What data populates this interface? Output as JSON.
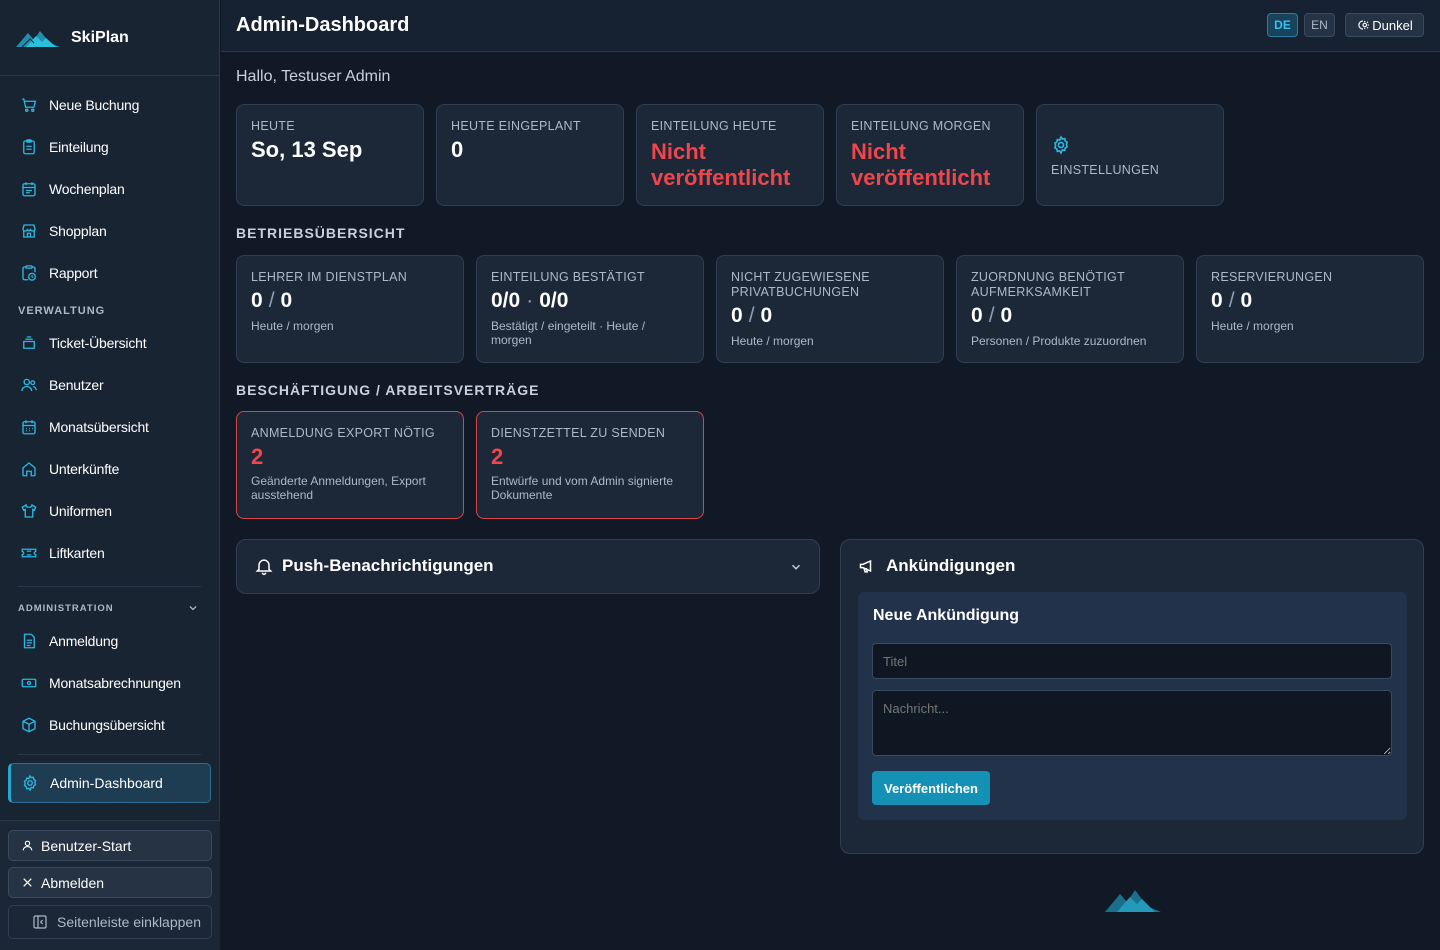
{
  "app": {
    "name": "SkiPlan"
  },
  "nav": {
    "items": [
      {
        "label": "Neue Buchung",
        "icon": "cart-icon"
      },
      {
        "label": "Einteilung",
        "icon": "clipboard-icon"
      },
      {
        "label": "Wochenplan",
        "icon": "calendar-icon"
      },
      {
        "label": "Shopplan",
        "icon": "store-icon"
      },
      {
        "label": "Rapport",
        "icon": "report-clock-icon"
      }
    ],
    "section_verwaltung": "VERWALTUNG",
    "verwaltung_items": [
      {
        "label": "Ticket-Übersicht",
        "icon": "ticket-stack-icon"
      },
      {
        "label": "Benutzer",
        "icon": "users-icon"
      },
      {
        "label": "Monatsübersicht",
        "icon": "calendar-grid-icon"
      },
      {
        "label": "Unterkünfte",
        "icon": "home-icon"
      },
      {
        "label": "Uniformen",
        "icon": "shirt-icon"
      },
      {
        "label": "Liftkarten",
        "icon": "ticket-icon"
      }
    ],
    "section_admin": "ADMINISTRATION",
    "admin_items": [
      {
        "label": "Anmeldung",
        "icon": "document-icon"
      },
      {
        "label": "Monatsabrechnungen",
        "icon": "money-icon"
      },
      {
        "label": "Buchungsübersicht",
        "icon": "box-icon"
      }
    ],
    "active": {
      "label": "Admin-Dashboard",
      "icon": "gear-icon"
    }
  },
  "footer": {
    "user_start": "Benutzer-Start",
    "logout": "Abmelden",
    "collapse": "Seitenleiste einklappen"
  },
  "header": {
    "title": "Admin-Dashboard",
    "lang_de": "DE",
    "lang_en": "EN",
    "theme": "Dunkel"
  },
  "greeting": "Hallo, Testuser Admin",
  "top_cards": [
    {
      "label": "HEUTE",
      "value": "So, 13 Sep"
    },
    {
      "label": "HEUTE EINGEPLANT",
      "value": "0"
    },
    {
      "label": "EINTEILUNG HEUTE",
      "value_line1": "Nicht",
      "value_line2": "veröffentlicht"
    },
    {
      "label": "EINTEILUNG MORGEN",
      "value_line1": "Nicht",
      "value_line2": "veröffentlicht"
    },
    {
      "label": "EINSTELLUNGEN"
    }
  ],
  "betrieb": {
    "heading": "BETRIEBSÜBERSICHT",
    "cards": [
      {
        "label": "LEHRER IM DIENSTPLAN",
        "a": "0",
        "b": "0",
        "sub": "Heute / morgen"
      },
      {
        "label": "EINTEILUNG BESTÄTIGT",
        "a": "0/0",
        "b": "0/0",
        "sub": "Bestätigt / eingeteilt · Heute / morgen"
      },
      {
        "label1": "NICHT ZUGEWIESENE",
        "label2": "PRIVATBUCHUNGEN",
        "a": "0",
        "b": "0",
        "sub": "Heute / morgen"
      },
      {
        "label1": "ZUORDNUNG BENÖTIGT",
        "label2": "AUFMERKSAMKEIT",
        "a": "0",
        "b": "0",
        "sub": "Personen / Produkte zuzuordnen"
      },
      {
        "label": "RESERVIERUNGEN",
        "a": "0",
        "b": "0",
        "sub": "Heute / morgen"
      }
    ]
  },
  "beschaeftigung": {
    "heading": "BESCHÄFTIGUNG / ARBEITSVERTRÄGE",
    "cards": [
      {
        "label": "ANMELDUNG EXPORT NÖTIG",
        "value": "2",
        "sub1": "Geänderte Anmeldungen, Export",
        "sub2": "ausstehend"
      },
      {
        "label": "DIENSTZETTEL ZU SENDEN",
        "value": "2",
        "sub1": "Entwürfe und vom Admin signierte",
        "sub2": "Dokumente"
      }
    ]
  },
  "push": {
    "title": "Push-Benachrichtigungen"
  },
  "announcements": {
    "title": "Ankündigungen",
    "new_title": "Neue Ankündigung",
    "title_placeholder": "Titel",
    "message_placeholder": "Nachricht...",
    "publish": "Veröffentlichen"
  },
  "colors": {
    "accent": "#29a6cf",
    "warning": "#f0454b",
    "background": "#111927",
    "card": "#1c2838"
  }
}
